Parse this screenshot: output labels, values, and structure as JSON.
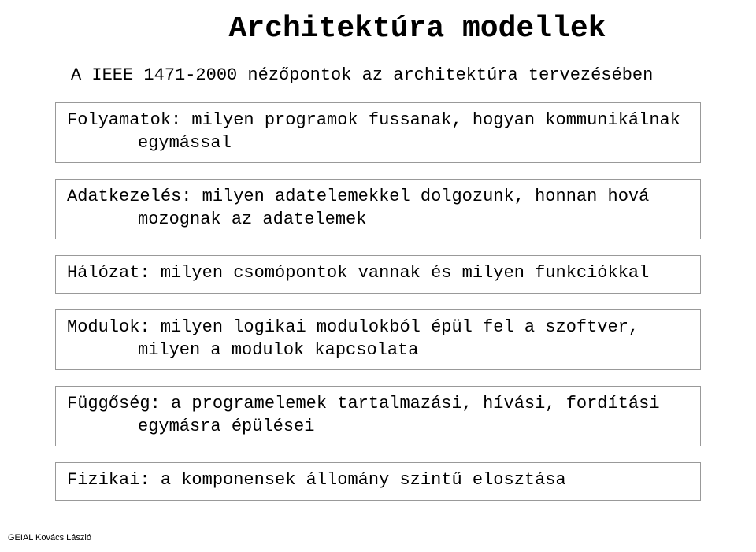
{
  "title": "Architektúra modellek",
  "subtitle": "A IEEE 1471-2000 nézőpontok az architektúra tervezésében",
  "boxes": {
    "b1": {
      "line1": "Folyamatok: milyen programok fussanak, hogyan kommunikálnak",
      "line2": "egymással"
    },
    "b2": {
      "line1": "Adatkezelés: milyen adatelemekkel dolgozunk, honnan hová",
      "line2": "mozognak az adatelemek"
    },
    "b3": {
      "line1": "Hálózat: milyen csomópontok vannak és milyen funkciókkal"
    },
    "b4": {
      "line1": "Modulok: milyen logikai modulokból épül fel a szoftver,",
      "line2": "milyen a modulok kapcsolata"
    },
    "b5": {
      "line1": "Függőség: a programelemek tartalmazási, hívási, fordítási",
      "line2": "egymásra épülései"
    },
    "b6": {
      "line1": "Fizikai: a komponensek állomány szintű elosztása"
    }
  },
  "footer": "GEIAL Kovács László"
}
